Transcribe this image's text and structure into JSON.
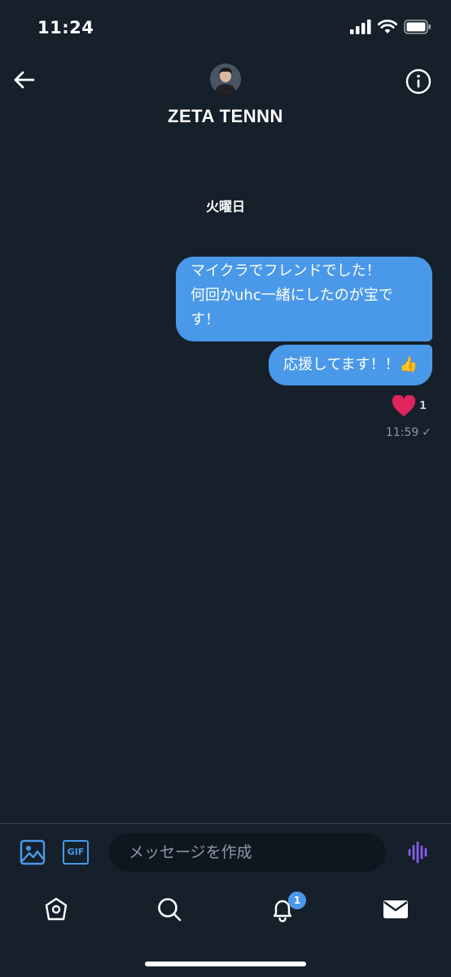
{
  "status_bar": {
    "time": "11:24"
  },
  "header": {
    "contact_name": "ZETA TENNN"
  },
  "conversation": {
    "day_label": "火曜日",
    "messages": [
      {
        "lines": [
          "マイクラでフレンドでした！",
          "何回かuhc一緒にしたのが宝で",
          "す！"
        ]
      },
      {
        "text": "応援してます！！👍"
      }
    ],
    "reaction": {
      "emoji": "heart",
      "count": "1"
    },
    "timestamp": "11:59",
    "read_mark": "✓"
  },
  "composer": {
    "gif_label": "GIF",
    "placeholder": "メッセージを作成"
  },
  "tab_bar": {
    "notifications_badge": "1"
  },
  "colors": {
    "background": "#15202b",
    "accent": "#4a99e9",
    "bubble": "#4a99e9",
    "heart": "#e0245e",
    "voice": "#8e5cf6"
  }
}
